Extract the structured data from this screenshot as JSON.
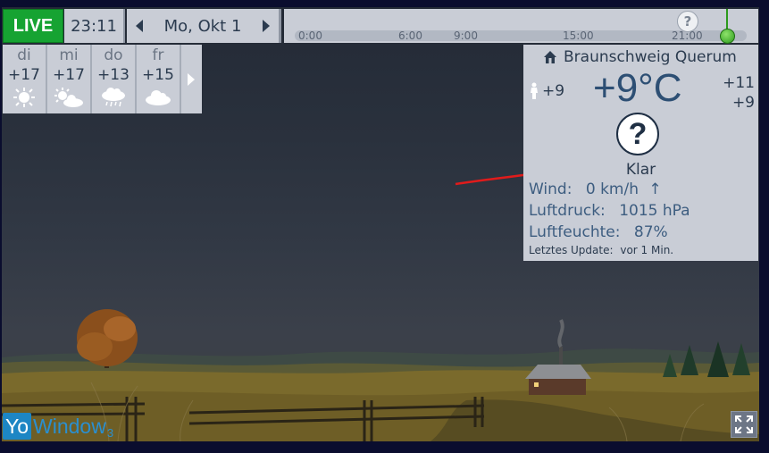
{
  "topbar": {
    "live_label": "LIVE",
    "time": "23:11",
    "date": "Mo, Okt 1",
    "help": "?",
    "timeline_ticks": [
      "0:00",
      "6:00",
      "9:00",
      "15:00",
      "21:00"
    ]
  },
  "forecast": {
    "days": [
      {
        "name": "di",
        "temp": "+17",
        "icon": "sun-icon"
      },
      {
        "name": "mi",
        "temp": "+17",
        "icon": "sun-cloud-icon"
      },
      {
        "name": "do",
        "temp": "+13",
        "icon": "rain-cloud-icon"
      },
      {
        "name": "fr",
        "temp": "+15",
        "icon": "cloud-icon"
      }
    ]
  },
  "current": {
    "location": "Braunschweig Querum",
    "feels_like": "+9",
    "temperature": "+9°C",
    "high": "+11",
    "low": "+9",
    "condition_icon_glyph": "?",
    "condition": "Klar",
    "wind_label": "Wind:",
    "wind_value": "0 km/h",
    "pressure_label": "Luftdruck:",
    "pressure_value": "1015 hPa",
    "humidity_label": "Luftfeuchte:",
    "humidity_value": "87%",
    "last_update_label": "Letztes Update:",
    "last_update_value": "vor 1 Min."
  },
  "branding": {
    "logo_yo": "Yo",
    "logo_window": "Window",
    "logo_version": "3"
  },
  "colors": {
    "live_green": "#16a332",
    "panel_bg": "#c9cdd6",
    "temp_blue": "#2d4f74",
    "annotation_red": "#e01b1b",
    "logo_blue": "#1d86c4"
  }
}
